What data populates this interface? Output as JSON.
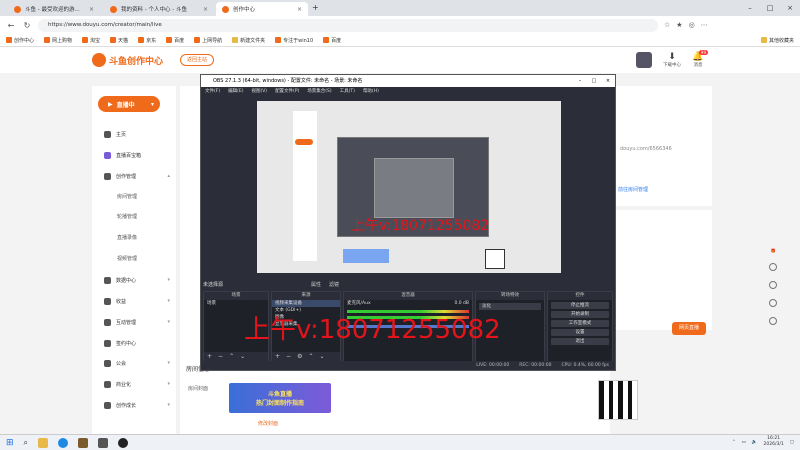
{
  "browser": {
    "tabs": [
      {
        "title": "斗鱼 - 最受欢迎的游...",
        "active": false
      },
      {
        "title": "我的资料 - 个人中心 - 斗鱼",
        "active": false
      },
      {
        "title": "创作中心",
        "active": true
      }
    ],
    "url": "https://www.douyu.com/creator/main/live",
    "bookmarks": [
      "创作中心",
      "网上购物",
      "淘宝",
      "天猫",
      "京东",
      "百度",
      "上网导航",
      "新建文件夹",
      "专注于win10",
      "百度"
    ],
    "other_bookmarks": "其他收藏夹"
  },
  "site": {
    "logo_text": "斗鱼创作中心",
    "return_label": "返回主站",
    "header_items": [
      {
        "label": "下载中心",
        "icon": "download-icon"
      },
      {
        "label": "消息",
        "icon": "bell-icon",
        "badge": "99"
      }
    ],
    "live_button": "直播中",
    "sidebar": [
      {
        "label": "主页",
        "icon": "home-icon"
      },
      {
        "label": "直播百宝箱",
        "icon": "box-icon"
      },
      {
        "label": "创作管理",
        "icon": "edit-icon"
      },
      {
        "label": "数据中心",
        "icon": "chart-icon"
      },
      {
        "label": "收益",
        "icon": "coin-icon"
      },
      {
        "label": "互动管理",
        "icon": "chat-icon"
      },
      {
        "label": "签约中心",
        "icon": "sign-icon"
      },
      {
        "label": "公会",
        "icon": "guild-icon"
      },
      {
        "label": "商业化",
        "icon": "shop-icon"
      },
      {
        "label": "创作成长",
        "icon": "growth-icon"
      }
    ],
    "sidebar_sub": [
      "房间管理",
      "轮播管理",
      "直播录像",
      "视频管理"
    ],
    "right_panel": {
      "url_fragment": "douyu.com/6566346",
      "link": "前往房间管理",
      "start_button": "网页直播"
    },
    "room_section_title": "房间信息",
    "room_cover_label": "房间封面",
    "cover_banner_line1": "斗鱼直播",
    "cover_banner_line2": "热门封面制作指南",
    "cover_link": "修改封面"
  },
  "obs": {
    "title": "OBS 27.1.3 (64-bit, windows) - 配置文件: 未命名 - 场景: 未命名",
    "menu": [
      "文件(F)",
      "编辑(E)",
      "视图(V)",
      "配置文件(P)",
      "场景集合(S)",
      "工具(T)",
      "帮助(H)"
    ],
    "no_source": "未选择源",
    "src_tabs": [
      "属性",
      "滤镜"
    ],
    "docks": {
      "scenes": {
        "header": "场景",
        "items": [
          "场景"
        ]
      },
      "sources": {
        "header": "来源",
        "items": [
          "视频采集设备",
          "文本 (GDI+)",
          "图像",
          "显示器采集"
        ]
      },
      "mixer": {
        "header": "混音器",
        "track": "麦克风/Aux",
        "level": "0.0 dB"
      },
      "transitions": {
        "header": "转场特效",
        "type": "淡化"
      },
      "controls": {
        "header": "控件",
        "buttons": [
          "停止推流",
          "开始录制",
          "工作室模式",
          "设置",
          "退出"
        ]
      }
    },
    "status": [
      "LIVE: 00:00:00",
      "REC: 00:00:00",
      "CPU: 0.4%, 60.00 fps"
    ]
  },
  "watermark": {
    "small": "上午v:18071255082",
    "big": "上午v:18071255082"
  },
  "taskbar": {
    "time": "16:21",
    "date": "2026/3/1"
  }
}
